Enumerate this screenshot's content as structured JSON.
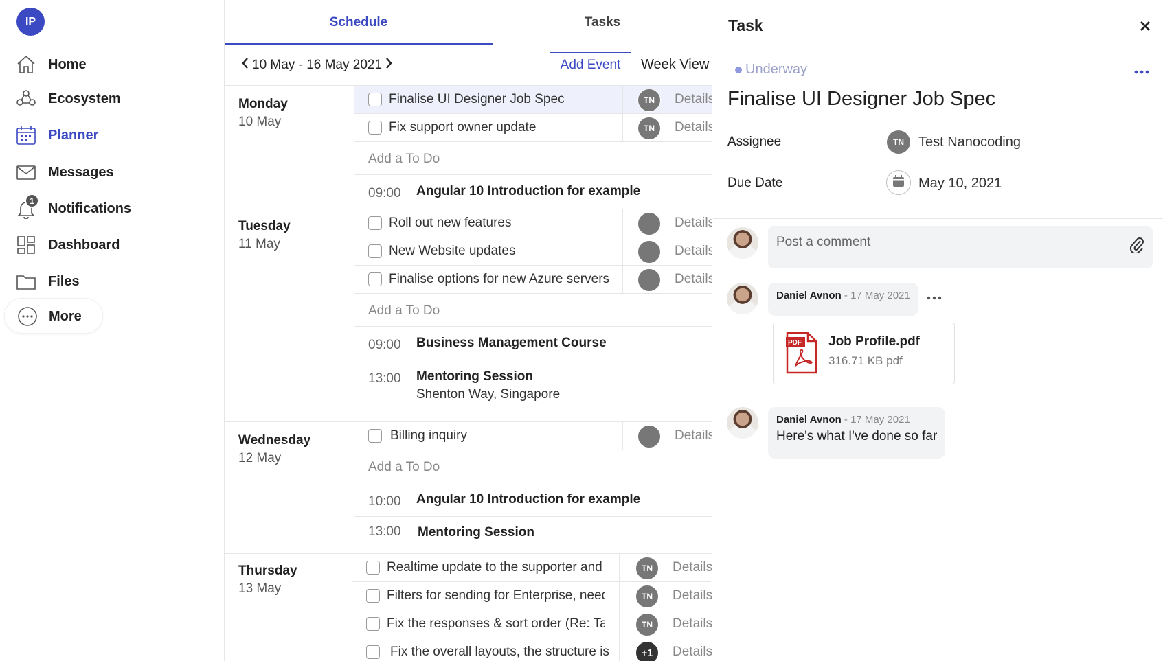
{
  "app": {
    "logo_initials": "IP"
  },
  "sidebar": {
    "items": [
      {
        "label": "Home",
        "icon": "home-icon"
      },
      {
        "label": "Ecosystem",
        "icon": "ecosystem-icon"
      },
      {
        "label": "Planner",
        "icon": "calendar-icon",
        "active": true
      },
      {
        "label": "Messages",
        "icon": "mail-icon"
      },
      {
        "label": "Notifications",
        "icon": "bell-icon",
        "badge": "1"
      },
      {
        "label": "Dashboard",
        "icon": "dashboard-icon"
      },
      {
        "label": "Files",
        "icon": "folder-icon"
      },
      {
        "label": "More",
        "icon": "more-icon"
      }
    ]
  },
  "tabs": {
    "schedule": "Schedule",
    "tasks": "Tasks"
  },
  "toolbar": {
    "range": "10 May - 16 May 2021",
    "add_event": "Add Event",
    "view": "Week View"
  },
  "schedule": {
    "details_label": "Details",
    "add_todo": "Add a To Do",
    "days": [
      {
        "name": "Monday",
        "date": "10 May",
        "tasks": [
          {
            "title": "Finalise UI Designer Job Spec",
            "assignee": "TN"
          },
          {
            "title": "Fix support owner update",
            "assignee": "TN"
          }
        ],
        "events": [
          {
            "time": "09:00",
            "title": "Angular 10 Introduction for example"
          }
        ]
      },
      {
        "name": "Tuesday",
        "date": "11 May",
        "tasks": [
          {
            "title": "Roll out new features"
          },
          {
            "title": "New Website updates"
          },
          {
            "title": "Finalise options for new Azure servers"
          }
        ],
        "events": [
          {
            "time": "09:00",
            "title": "Business Management Course"
          },
          {
            "time": "13:00",
            "title": "Mentoring Session",
            "location": "Shenton Way, Singapore"
          }
        ]
      },
      {
        "name": "Wednesday",
        "date": "12 May",
        "tasks": [
          {
            "title": "Billing inquiry"
          }
        ],
        "events": [
          {
            "time": "10:00",
            "title": "Angular 10 Introduction for example"
          },
          {
            "time": "13:00",
            "title": "Mentoring Session"
          }
        ]
      },
      {
        "name": "Thursday",
        "date": "13 May",
        "tasks": [
          {
            "title": "Realtime update to the supporter and user",
            "assignee": "TN"
          },
          {
            "title": "Filters for sending for Enterprise, need",
            "assignee": "TN"
          },
          {
            "title": "Fix the responses & sort order (Re: Task",
            "assignee": "TN"
          },
          {
            "title": "Fix the overall layouts, the structure is",
            "assignee": "+1"
          }
        ]
      }
    ]
  },
  "panel": {
    "title": "Task",
    "status": "Underway",
    "task_title": "Finalise UI Designer Job Spec",
    "assignee_label": "Assignee",
    "assignee_initials": "TN",
    "assignee_name": "Test Nanocoding",
    "due_label": "Due Date",
    "due_value": "May 10, 2021",
    "comment_placeholder": "Post a comment",
    "comments": [
      {
        "author": "Daniel Avnon",
        "date": " - 17 May 2021"
      },
      {
        "author": "Daniel Avnon",
        "date": " - 17 May 2021",
        "text": "Here's what I've done so far"
      }
    ],
    "attachment": {
      "name": "Job Profile.pdf",
      "meta": "316.71 KB pdf",
      "type_label": "PDF"
    }
  },
  "colors": {
    "accent": "#3b49c2",
    "status_dot": "#8e99de"
  }
}
